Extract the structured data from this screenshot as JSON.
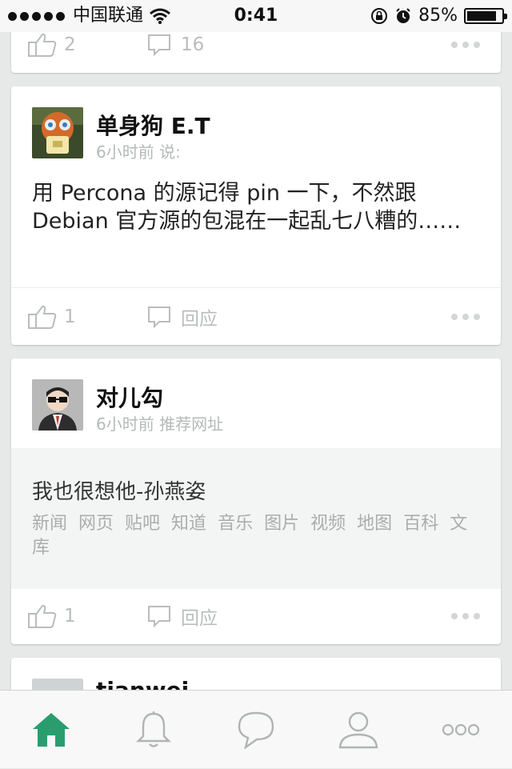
{
  "status_bar": {
    "carrier": "中国联通",
    "time": "0:41",
    "battery": "85%",
    "icons": [
      "signal-dots-icon",
      "wifi-icon",
      "rotation-lock-icon",
      "alarm-icon",
      "battery-icon"
    ]
  },
  "feed": {
    "posts": [
      {
        "likes": "2",
        "comments": "16"
      },
      {
        "author": "单身狗 E.T",
        "time": "6小时前",
        "verb": "说:",
        "text": "用 Percona 的源记得 pin 一下，不然跟 Debian 官方源的包混在一起乱七八糟的……",
        "likes": "1",
        "comment_label": "回应"
      },
      {
        "author": "对儿勾",
        "time": "6小时前",
        "verb": "推荐网址",
        "link_title": "我也很想他-孙燕姿",
        "link_desc": [
          "新闻",
          "网页",
          "贴吧",
          "知道",
          "音乐",
          "图片",
          "视频",
          "地图",
          "百科",
          "文库"
        ],
        "likes": "1",
        "comment_label": "回应"
      },
      {
        "author": "tianwei"
      }
    ]
  },
  "tabbar": {
    "tabs": [
      "home-icon",
      "bell-icon",
      "chat-bubble-icon",
      "profile-icon",
      "more-icon"
    ],
    "active_color": "#2a9d6f",
    "inactive_color": "#b0b4b2"
  }
}
